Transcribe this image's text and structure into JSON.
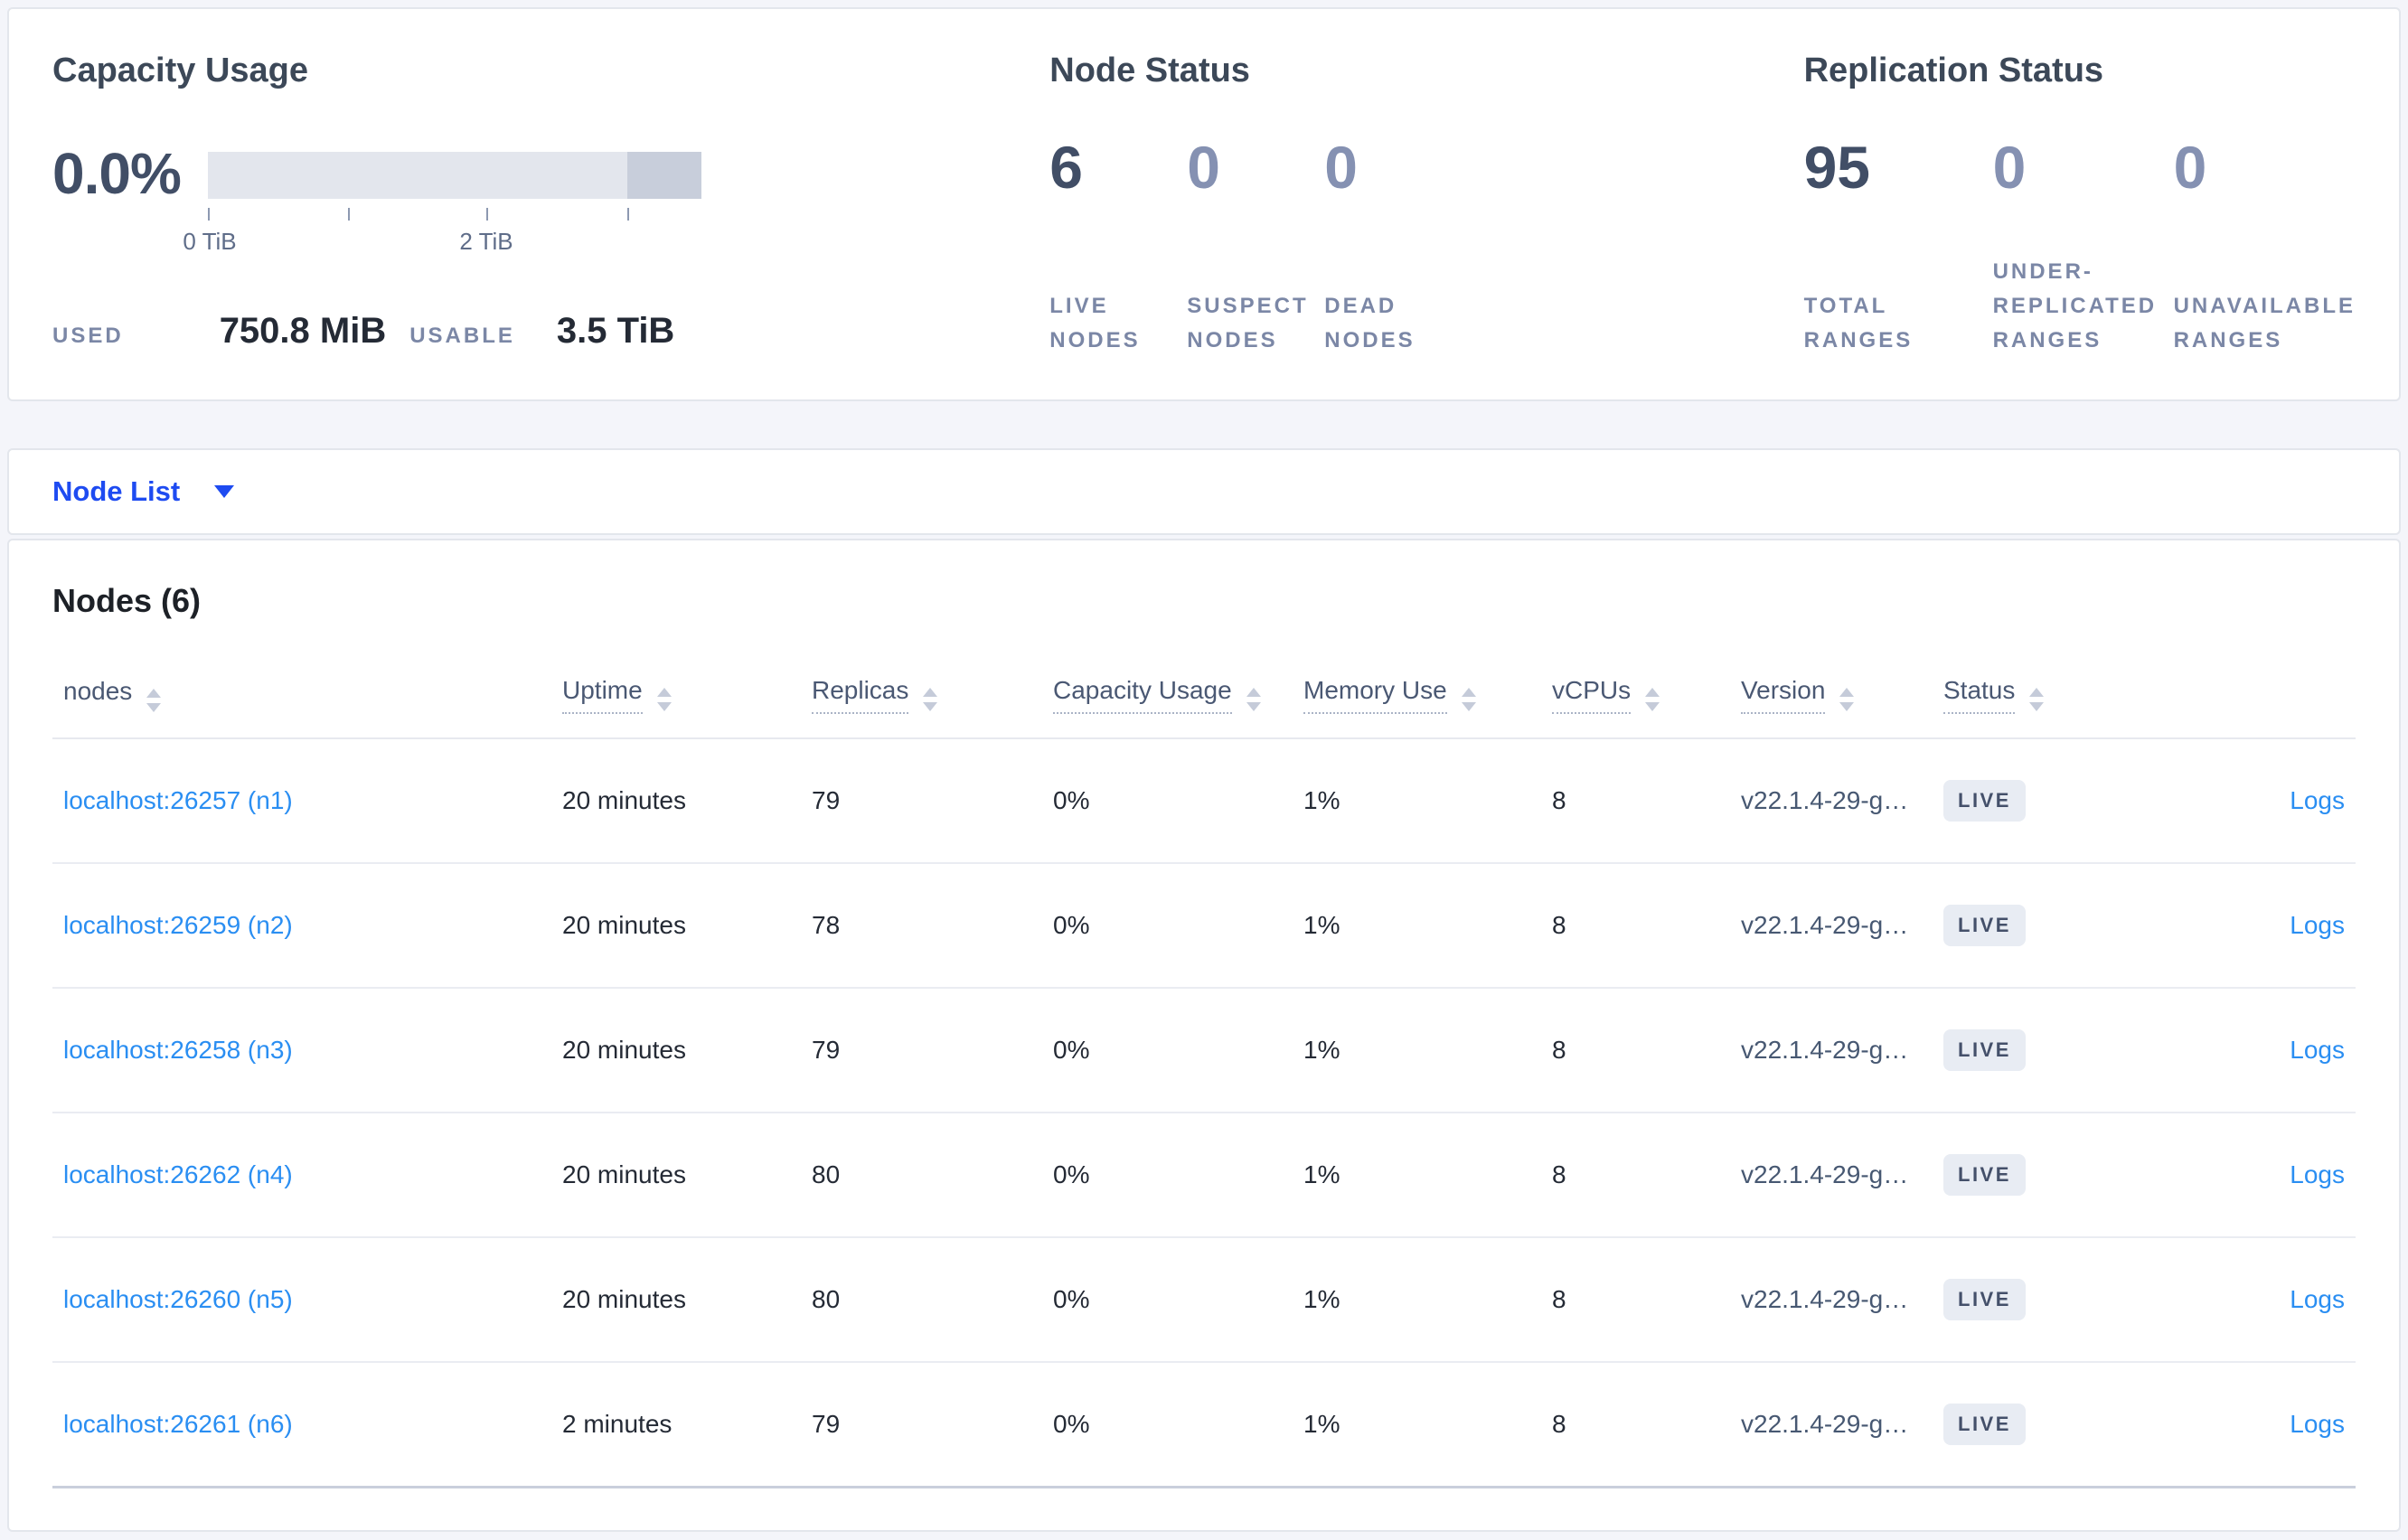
{
  "colors": {
    "accent_blue": "#1e4bf1",
    "link_blue": "#2a8ef2",
    "badge_bg": "#e8ecf3",
    "bar_light": "#e3e6ed",
    "bar_dark": "#c8cedb"
  },
  "capacity": {
    "title": "Capacity Usage",
    "percent": "0.0%",
    "axis_labels": [
      "0 TiB",
      "2 TiB"
    ],
    "gauge": {
      "max_tib": 3.5,
      "dark_segment_start_fraction": 0.85
    },
    "stats": [
      {
        "label": "USED",
        "value": "750.8 MiB"
      },
      {
        "label": "USABLE",
        "value": "3.5 TiB"
      }
    ]
  },
  "node_status": {
    "title": "Node Status",
    "metrics": [
      {
        "value": "6",
        "label_lines": [
          "LIVE",
          "NODES"
        ]
      },
      {
        "value": "0",
        "label_lines": [
          "SUSPECT",
          "NODES"
        ]
      },
      {
        "value": "0",
        "label_lines": [
          "DEAD",
          "NODES"
        ]
      }
    ]
  },
  "replication_status": {
    "title": "Replication Status",
    "metrics": [
      {
        "value": "95",
        "label_lines": [
          "TOTAL",
          "RANGES"
        ]
      },
      {
        "value": "0",
        "label_lines": [
          "UNDER-",
          "REPLICATED",
          "RANGES"
        ]
      },
      {
        "value": "0",
        "label_lines": [
          "UNAVAILABLE",
          "RANGES"
        ]
      }
    ]
  },
  "node_list": {
    "label": "Node List"
  },
  "nodes_table": {
    "title": "Nodes (6)",
    "columns": [
      "nodes",
      "Uptime",
      "Replicas",
      "Capacity Usage",
      "Memory Use",
      "vCPUs",
      "Version",
      "Status"
    ],
    "logs_label": "Logs",
    "rows": [
      {
        "node": "localhost:26257 (n1)",
        "uptime": "20 minutes",
        "replicas": "79",
        "capacity_usage": "0%",
        "memory_use": "1%",
        "vcpus": "8",
        "version": "v22.1.4-29-g…",
        "status": "LIVE"
      },
      {
        "node": "localhost:26259 (n2)",
        "uptime": "20 minutes",
        "replicas": "78",
        "capacity_usage": "0%",
        "memory_use": "1%",
        "vcpus": "8",
        "version": "v22.1.4-29-g…",
        "status": "LIVE"
      },
      {
        "node": "localhost:26258 (n3)",
        "uptime": "20 minutes",
        "replicas": "79",
        "capacity_usage": "0%",
        "memory_use": "1%",
        "vcpus": "8",
        "version": "v22.1.4-29-g…",
        "status": "LIVE"
      },
      {
        "node": "localhost:26262 (n4)",
        "uptime": "20 minutes",
        "replicas": "80",
        "capacity_usage": "0%",
        "memory_use": "1%",
        "vcpus": "8",
        "version": "v22.1.4-29-g…",
        "status": "LIVE"
      },
      {
        "node": "localhost:26260 (n5)",
        "uptime": "20 minutes",
        "replicas": "80",
        "capacity_usage": "0%",
        "memory_use": "1%",
        "vcpus": "8",
        "version": "v22.1.4-29-g…",
        "status": "LIVE"
      },
      {
        "node": "localhost:26261 (n6)",
        "uptime": "2 minutes",
        "replicas": "79",
        "capacity_usage": "0%",
        "memory_use": "1%",
        "vcpus": "8",
        "version": "v22.1.4-29-g…",
        "status": "LIVE"
      }
    ]
  }
}
